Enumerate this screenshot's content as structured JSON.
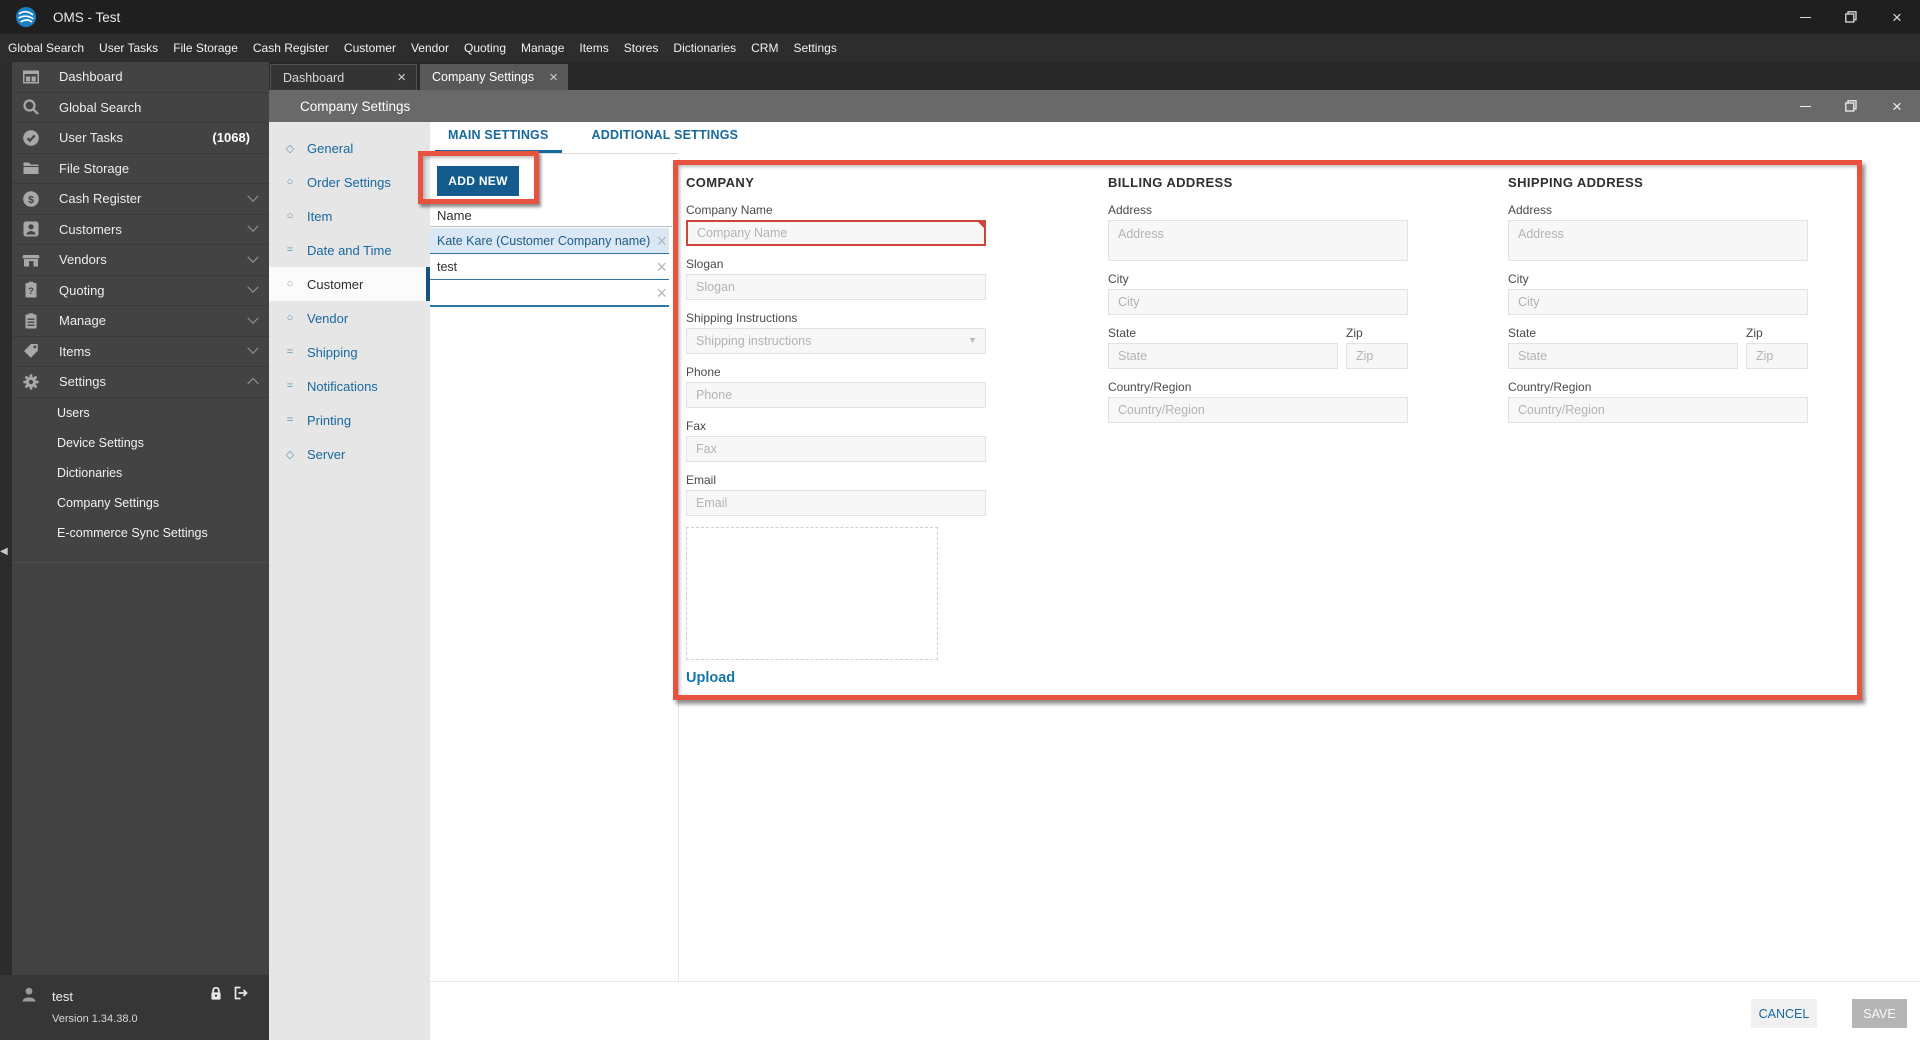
{
  "titlebar": {
    "title": "OMS - Test"
  },
  "menubar": {
    "items": [
      "Global Search",
      "User Tasks",
      "File Storage",
      "Cash Register",
      "Customer",
      "Vendor",
      "Quoting",
      "Manage",
      "Items",
      "Stores",
      "Dictionaries",
      "CRM",
      "Settings"
    ]
  },
  "sidebar": {
    "items": [
      {
        "label": "Dashboard"
      },
      {
        "label": "Global Search"
      },
      {
        "label": "User Tasks",
        "badge": "(1068)"
      },
      {
        "label": "File Storage"
      },
      {
        "label": "Cash Register"
      },
      {
        "label": "Customers"
      },
      {
        "label": "Vendors"
      },
      {
        "label": "Quoting"
      },
      {
        "label": "Manage"
      },
      {
        "label": "Items"
      },
      {
        "label": "Settings"
      }
    ],
    "settings_children": [
      {
        "label": "Users"
      },
      {
        "label": "Device Settings"
      },
      {
        "label": "Dictionaries"
      },
      {
        "label": "Company Settings"
      },
      {
        "label": "E-commerce Sync Settings"
      }
    ],
    "user": {
      "name": "test",
      "version": "Version 1.34.38.0"
    }
  },
  "tabstrip": {
    "tabs": [
      {
        "label": "Dashboard"
      },
      {
        "label": "Company Settings"
      }
    ]
  },
  "window": {
    "title": "Company Settings"
  },
  "settings_nav": {
    "items": [
      {
        "glyph": "◇",
        "label": "General"
      },
      {
        "glyph": "○",
        "label": "Order Settings"
      },
      {
        "glyph": "○",
        "label": "Item"
      },
      {
        "glyph": "=",
        "label": "Date and Time"
      },
      {
        "glyph": "○",
        "label": "Customer"
      },
      {
        "glyph": "○",
        "label": "Vendor"
      },
      {
        "glyph": "=",
        "label": "Shipping"
      },
      {
        "glyph": "=",
        "label": "Notifications"
      },
      {
        "glyph": "=",
        "label": "Printing"
      },
      {
        "glyph": "◇",
        "label": "Server"
      }
    ]
  },
  "main_tabs": {
    "main": "MAIN SETTINGS",
    "additional": "ADDITIONAL SETTINGS"
  },
  "add_new_label": "ADD NEW",
  "name_list": {
    "header": "Name",
    "rows": [
      {
        "text": "Kate Kare (Customer Company name)"
      },
      {
        "text": "test"
      },
      {
        "text": ""
      }
    ]
  },
  "form": {
    "company": {
      "title": "COMPANY",
      "company_name": {
        "label": "Company Name",
        "placeholder": "Company Name"
      },
      "slogan": {
        "label": "Slogan",
        "placeholder": "Slogan"
      },
      "shipping_instructions": {
        "label": "Shipping Instructions",
        "placeholder": "Shipping instructions"
      },
      "phone": {
        "label": "Phone",
        "placeholder": "Phone"
      },
      "fax": {
        "label": "Fax",
        "placeholder": "Fax"
      },
      "email": {
        "label": "Email",
        "placeholder": "Email"
      },
      "upload_label": "Upload"
    },
    "billing": {
      "title": "BILLING ADDRESS",
      "address": {
        "label": "Address",
        "placeholder": "Address"
      },
      "city": {
        "label": "City",
        "placeholder": "City"
      },
      "state": {
        "label": "State",
        "placeholder": "State"
      },
      "zip": {
        "label": "Zip",
        "placeholder": "Zip"
      },
      "country": {
        "label": "Country/Region",
        "placeholder": "Country/Region"
      }
    },
    "shipping": {
      "title": "SHIPPING ADDRESS",
      "address": {
        "label": "Address",
        "placeholder": "Address"
      },
      "city": {
        "label": "City",
        "placeholder": "City"
      },
      "state": {
        "label": "State",
        "placeholder": "State"
      },
      "zip": {
        "label": "Zip",
        "placeholder": "Zip"
      },
      "country": {
        "label": "Country/Region",
        "placeholder": "Country/Region"
      }
    }
  },
  "footer": {
    "cancel_label": "CANCEL",
    "save_label": "SAVE"
  },
  "colors": {
    "annotation_red": "#e8523e",
    "accent_blue": "#17699e",
    "button_blue": "#135b8d",
    "error_red": "#d0453a",
    "selected_row_bg": "#d9e8f4",
    "selected_nav_bar": "#14537e"
  }
}
